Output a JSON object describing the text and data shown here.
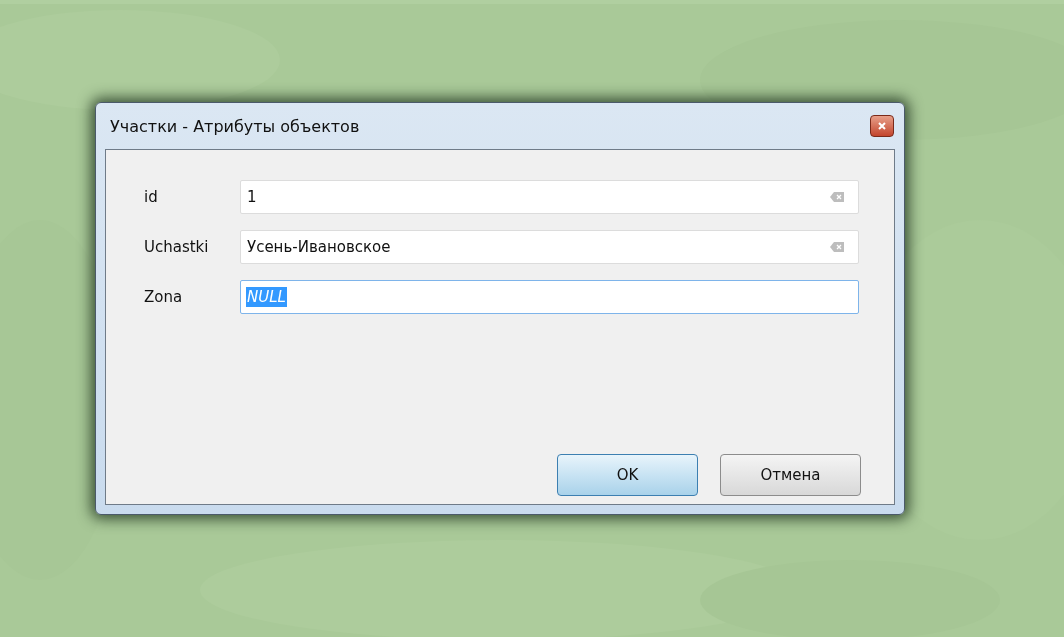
{
  "dialog": {
    "title": "Участки - Атрибуты объектов",
    "fields": [
      {
        "label": "id",
        "value": "1",
        "italic": false,
        "text_selected": false,
        "focused": false,
        "clear_button": true
      },
      {
        "label": "Uchastki",
        "value": "Усень-Ивановское",
        "italic": false,
        "text_selected": false,
        "focused": false,
        "clear_button": true
      },
      {
        "label": "Zona",
        "value": "NULL",
        "italic": true,
        "text_selected": true,
        "focused": true,
        "clear_button": false
      }
    ],
    "buttons": [
      {
        "label": "OK",
        "default": true
      },
      {
        "label": "Отмена",
        "default": false
      }
    ]
  }
}
